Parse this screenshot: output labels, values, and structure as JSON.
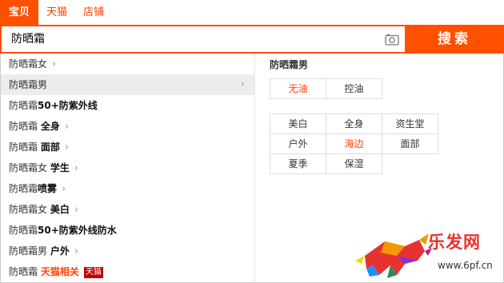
{
  "tabs": [
    {
      "label": "宝贝",
      "active": true
    },
    {
      "label": "天猫",
      "active": false
    },
    {
      "label": "店铺",
      "active": false
    }
  ],
  "search": {
    "value": "防晒霜",
    "button_label": "搜索",
    "camera_icon": "camera-icon"
  },
  "suggestions": [
    {
      "base": "防晒霜女",
      "extra": "",
      "extra_style": "",
      "chevron": true
    },
    {
      "base": "防晒霜男",
      "extra": "",
      "extra_style": "",
      "chevron": true,
      "hover": true
    },
    {
      "base": "防晒霜",
      "extra": "50+防紫外线",
      "extra_style": "bold",
      "chevron": false
    },
    {
      "base": "防晒霜 ",
      "extra": "全身",
      "extra_style": "bold",
      "chevron": true
    },
    {
      "base": "防晒霜 ",
      "extra": "面部",
      "extra_style": "bold",
      "chevron": true
    },
    {
      "base": "防晒霜女 ",
      "extra": "学生",
      "extra_style": "bold",
      "chevron": true
    },
    {
      "base": "防晒霜",
      "extra": "喷雾",
      "extra_style": "bold",
      "chevron": true
    },
    {
      "base": "防晒霜女 ",
      "extra": "美白",
      "extra_style": "bold",
      "chevron": true
    },
    {
      "base": "防晒霜",
      "extra": "50+防紫外线防水",
      "extra_style": "bold",
      "chevron": false
    },
    {
      "base": "防晒霜男 ",
      "extra": "户外",
      "extra_style": "bold",
      "chevron": true
    },
    {
      "base": "防晒霜 ",
      "extra": "天猫相关",
      "extra_style": "red",
      "chevron": false,
      "badge": "天猫"
    }
  ],
  "panel": {
    "title": "防晒霜男",
    "group1": [
      {
        "label": "无油",
        "accent": true
      },
      {
        "label": "控油",
        "accent": false
      }
    ],
    "group2": [
      {
        "label": "美白",
        "accent": false
      },
      {
        "label": "全身",
        "accent": false
      },
      {
        "label": "资生堂",
        "accent": false
      },
      {
        "label": "户外",
        "accent": false
      },
      {
        "label": "海边",
        "accent": true
      },
      {
        "label": "面部",
        "accent": false
      },
      {
        "label": "夏季",
        "accent": false
      },
      {
        "label": "保湿",
        "accent": false
      }
    ]
  },
  "watermark": {
    "logo_text": "乐发网",
    "url": "www.6pf.cn",
    "accent_color": "#e8322f",
    "brand_color": "#ff5000"
  }
}
